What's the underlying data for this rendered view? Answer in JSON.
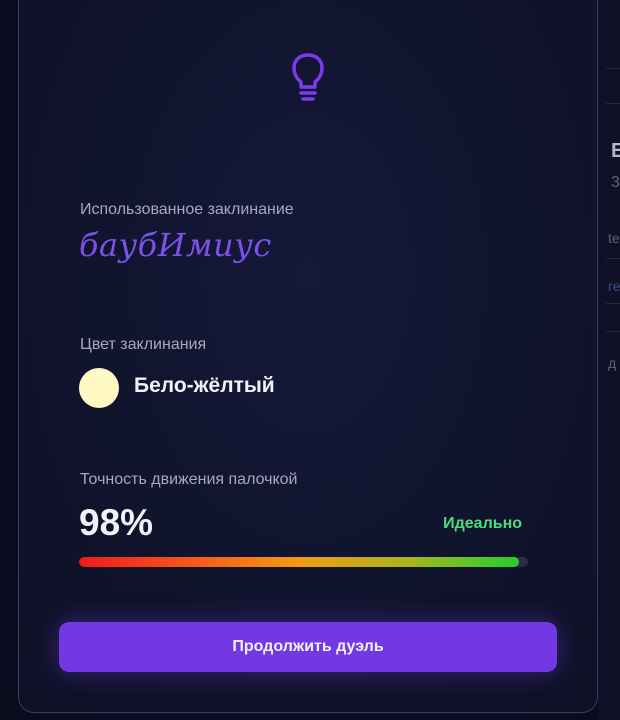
{
  "background": {
    "snippets": [
      "E",
      "3",
      "te",
      "re",
      "д"
    ]
  },
  "card": {
    "icon": "lightbulb-icon",
    "spell": {
      "label": "Использованное заклинание",
      "name": "баубИмиус"
    },
    "color": {
      "label": "Цвет заклинания",
      "name": "Бело-жёлтый",
      "swatch_hex": "#fffac4"
    },
    "accuracy": {
      "label": "Точность движения палочкой",
      "value": "98%",
      "fraction": 0.98,
      "rating": "Идеально"
    },
    "continue_button": "Продолжить дуэль"
  },
  "colors": {
    "accent": "#7238e4",
    "spell_text": "#7c52e6",
    "success": "#4ade80"
  }
}
